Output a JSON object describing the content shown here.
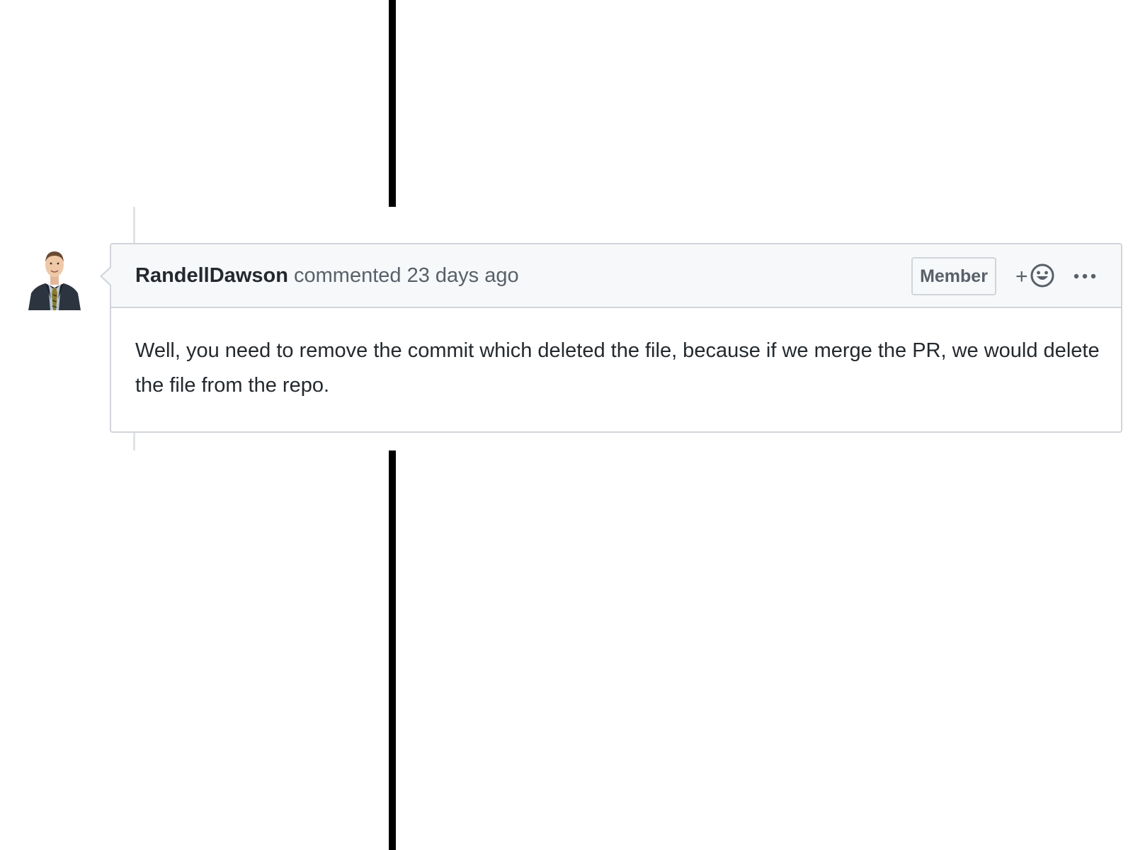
{
  "comment": {
    "author": "RandellDawson",
    "action": "commented",
    "timestamp": "23 days ago",
    "badge": "Member",
    "reaction": {
      "plus_label": "+",
      "icon": "smiley-icon"
    },
    "more_icon": "kebab-horizontal-icon",
    "body": "Well, you need to remove the commit which deleted the file, because if we merge the PR, we would delete the file from the repo."
  }
}
